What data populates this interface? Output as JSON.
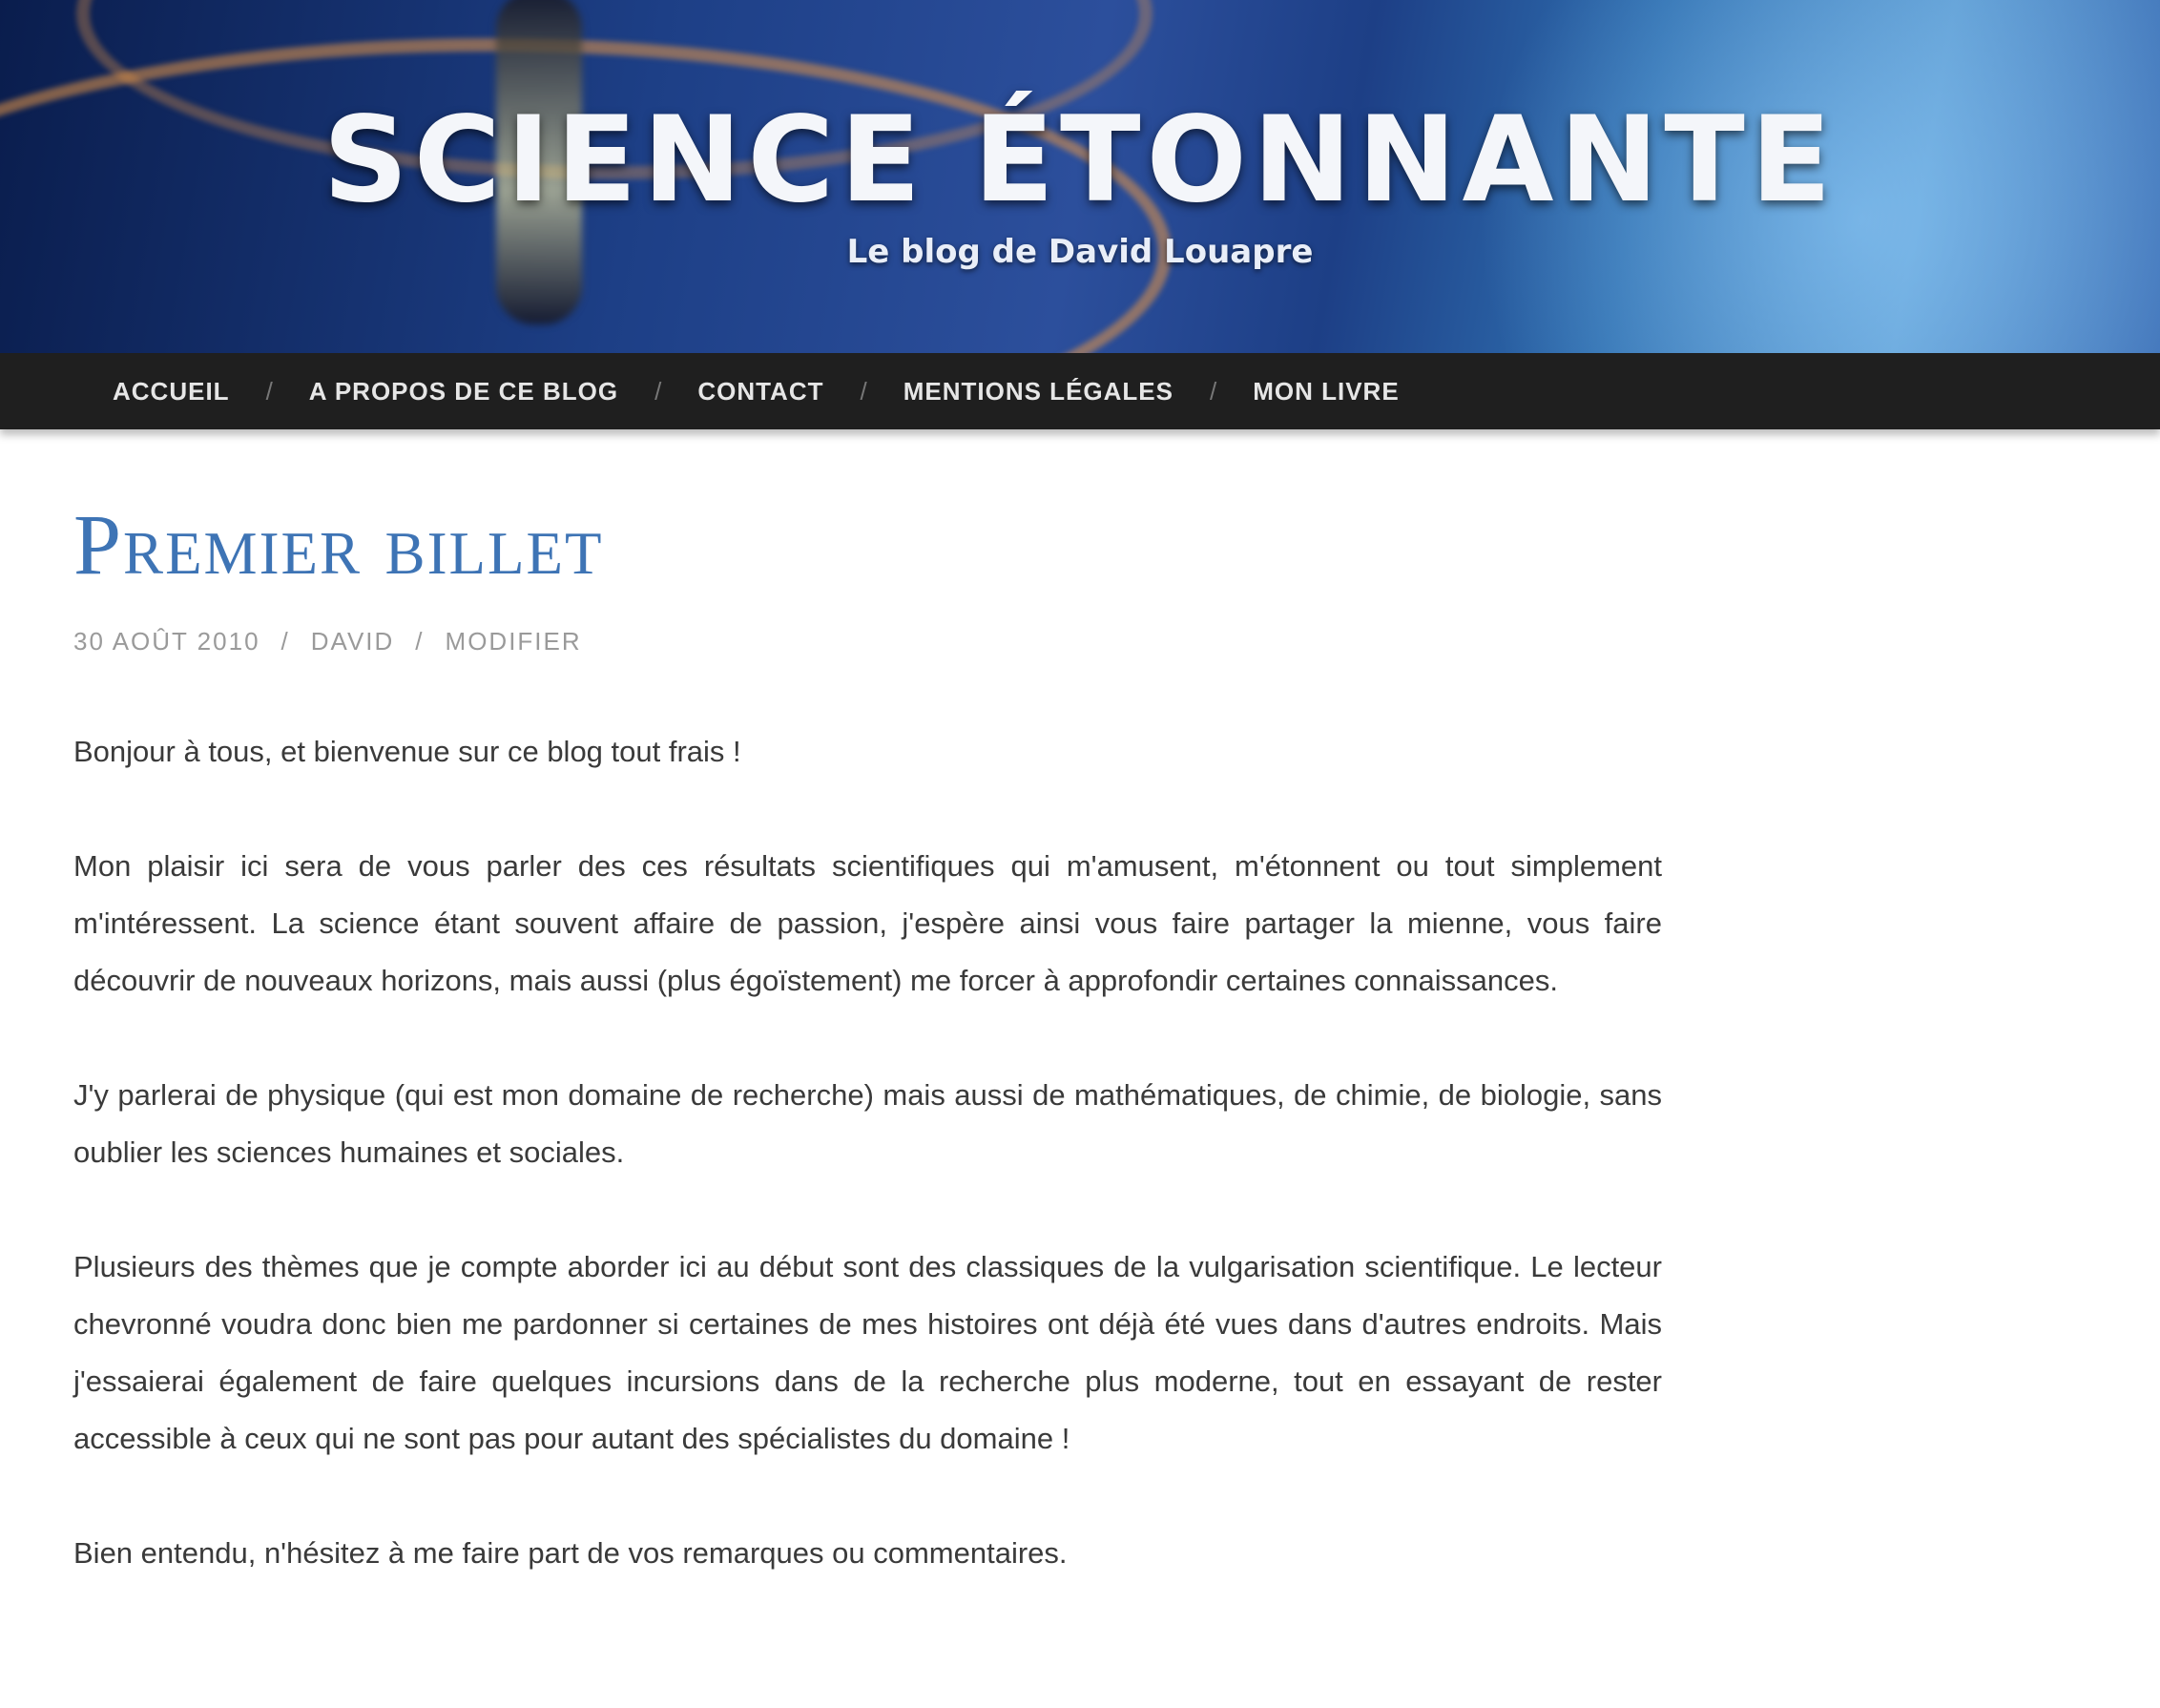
{
  "header": {
    "site_title": "SCIENCE ÉTONNANTE",
    "tagline": "Le blog de David Louapre"
  },
  "nav": {
    "items": [
      {
        "label": "ACCUEIL"
      },
      {
        "label": "A PROPOS DE CE BLOG"
      },
      {
        "label": "CONTACT"
      },
      {
        "label": "MENTIONS LÉGALES"
      },
      {
        "label": "MON LIVRE"
      }
    ],
    "separator": "/"
  },
  "post": {
    "title": "Premier billet",
    "date": "30 AOÛT 2010",
    "author": "DAVID",
    "edit_label": "MODIFIER",
    "meta_separator": "/",
    "paragraphs": [
      "Bonjour à tous, et bienvenue sur ce blog tout frais !",
      "Mon plaisir ici sera de vous parler des ces résultats scientifiques qui m'amusent, m'étonnent ou tout simplement m'intéressent. La science étant souvent affaire de passion, j'espère ainsi vous faire partager la mienne, vous faire découvrir de nouveaux horizons, mais aussi (plus égoïstement) me forcer à approfondir certaines connaissances.",
      "J'y parlerai de physique (qui est mon domaine de recherche) mais aussi de mathématiques, de chimie, de biologie, sans oublier les sciences humaines et sociales.",
      "Plusieurs des thèmes que je compte aborder ici au début sont des classiques de la vulgarisation scientifique. Le lecteur chevronné voudra donc bien me pardonner si certaines de mes histoires ont déjà été vues dans d'autres endroits. Mais j'essaierai également de faire quelques incursions dans de la recherche plus moderne, tout en essayant de rester accessible à ceux qui ne sont pas pour autant des spécialistes du domaine !",
      "Bien entendu, n'hésitez à me faire part de vos remarques ou commentaires."
    ]
  },
  "colors": {
    "title_blue": "#3e74b5",
    "nav_bg": "#1f1f1f"
  }
}
